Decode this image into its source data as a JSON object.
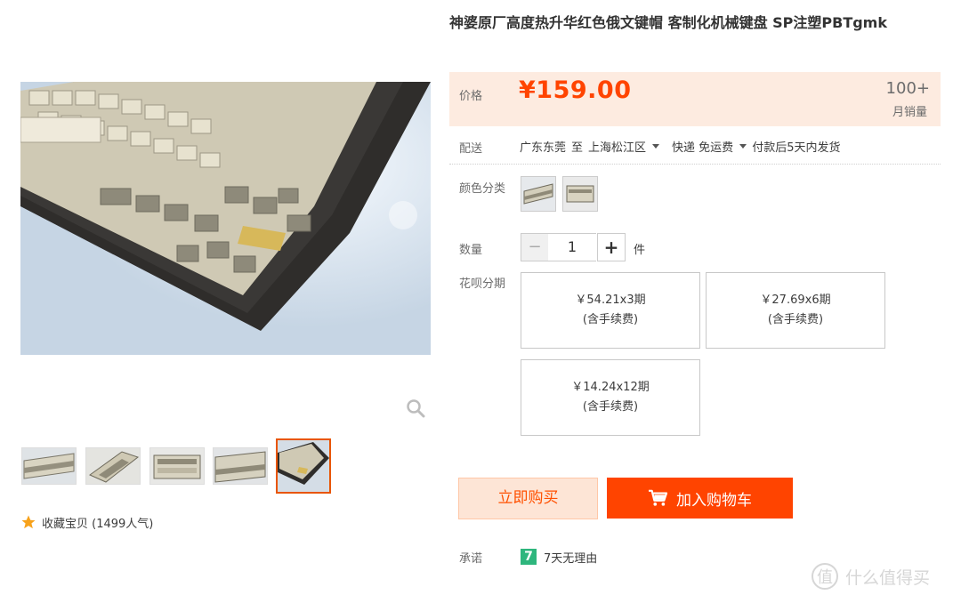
{
  "product": {
    "title": "神婆原厂高度热升华红色俄文键帽 客制化机械键盘 SP注塑PBTgmk"
  },
  "price": {
    "label": "价格",
    "value": "¥159.00",
    "sales_count": "100+",
    "sales_label": "月销量"
  },
  "shipping": {
    "label": "配送",
    "from": "广东东莞",
    "to_word": "至",
    "to": "上海松江区",
    "method": "快递 免运费",
    "note": "付款后5天内发货"
  },
  "color": {
    "label": "颜色分类"
  },
  "quantity": {
    "label": "数量",
    "minus": "−",
    "value": "1",
    "plus": "+",
    "unit": "件"
  },
  "installment": {
    "label": "花呗分期",
    "options": [
      {
        "amount": "￥54.21x3期",
        "fee": "(含手续费)"
      },
      {
        "amount": "￥27.69x6期",
        "fee": "(含手续费)"
      },
      {
        "amount": "￥14.24x12期",
        "fee": "(含手续费)"
      }
    ]
  },
  "actions": {
    "buy_now": "立即购买",
    "add_to_cart": "加入购物车"
  },
  "promise": {
    "label": "承诺",
    "badge": "7",
    "text": "7天无理由"
  },
  "favorite": {
    "text": "收藏宝贝 (1499人气)"
  },
  "watermark": {
    "icon": "值",
    "text": "什么值得买"
  },
  "colors": {
    "accent": "#ff4400",
    "price_bg": "#fdebe0",
    "promise_green": "#2eb67d"
  },
  "icons": {
    "zoom": "magnifier-icon",
    "star": "star-icon",
    "cart": "cart-icon"
  }
}
